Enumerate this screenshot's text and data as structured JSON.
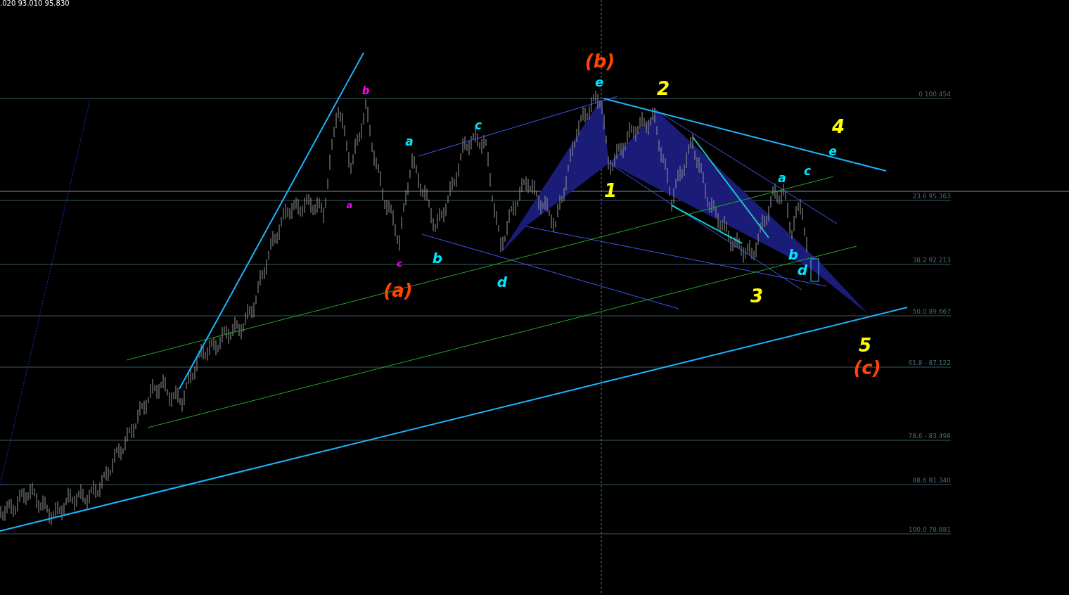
{
  "quote_header": ".020 93.010 95.830",
  "fib_levels": [
    "0 100.454",
    "23.6 95.363",
    "38.2 92.213",
    "50.0 89.667",
    "61.8 - 87.122",
    "78.6 - 83.498",
    "88.6 81.340",
    "100.0 78.881"
  ],
  "wave_labels": [
    {
      "text": "(b)",
      "color": "#ff4500"
    },
    {
      "text": "e",
      "color": "#00e5ff"
    },
    {
      "text": "b",
      "color": "#ff00ff"
    },
    {
      "text": "2",
      "color": "#ffff00"
    },
    {
      "text": "c",
      "color": "#00e5ff"
    },
    {
      "text": "4",
      "color": "#ffff00"
    },
    {
      "text": "a",
      "color": "#00e5ff"
    },
    {
      "text": "e",
      "color": "#00e5ff"
    },
    {
      "text": "c",
      "color": "#00e5ff"
    },
    {
      "text": "a",
      "color": "#00e5ff"
    },
    {
      "text": "1",
      "color": "#ffff00"
    },
    {
      "text": "a",
      "color": "#ff00ff"
    },
    {
      "text": "c",
      "color": "#ff00ff"
    },
    {
      "text": "b",
      "color": "#00e5ff"
    },
    {
      "text": "b",
      "color": "#00e5ff"
    },
    {
      "text": "d",
      "color": "#00e5ff"
    },
    {
      "text": "(a)",
      "color": "#ff4500"
    },
    {
      "text": "d",
      "color": "#00e5ff"
    },
    {
      "text": "3",
      "color": "#ffff00"
    },
    {
      "text": "5",
      "color": "#ffff00"
    },
    {
      "text": "(c)",
      "color": "#ff4500"
    }
  ]
}
